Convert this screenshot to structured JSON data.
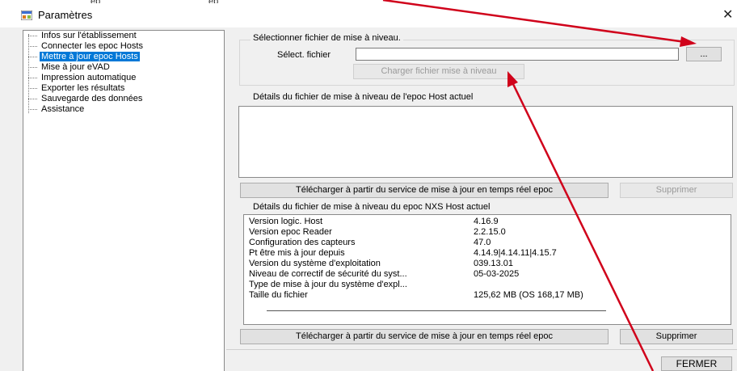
{
  "window": {
    "title": "Paramètres",
    "close_glyph": "✕"
  },
  "top_fragments": [
    "ep",
    "ep"
  ],
  "tree": {
    "items": [
      {
        "label": "Infos sur l'établissement",
        "selected": false
      },
      {
        "label": "Connecter les epoc Hosts",
        "selected": false
      },
      {
        "label": "Mettre à jour epoc Hosts",
        "selected": true
      },
      {
        "label": "Mise à jour eVAD",
        "selected": false
      },
      {
        "label": "Impression automatique",
        "selected": false
      },
      {
        "label": "Exporter les résultats",
        "selected": false
      },
      {
        "label": "Sauvegarde des données",
        "selected": false
      },
      {
        "label": "Assistance",
        "selected": false
      }
    ]
  },
  "upgrade_file": {
    "group_label": "Sélectionner fichier de mise à niveau.",
    "select_label": "Sélect. fichier",
    "file_value": "",
    "browse_label": "...",
    "load_label": "Charger fichier mise à niveau"
  },
  "current_details": {
    "label": "Détails du fichier de mise à niveau de l'epoc Host actuel",
    "download_label": "Télécharger à partir du service de mise à jour en temps réel epoc",
    "delete_label": "Supprimer"
  },
  "nxs_details": {
    "label": "Détails du fichier de mise à niveau du epoc NXS Host actuel",
    "rows": [
      {
        "key": "Version logic. Host",
        "value": "4.16.9"
      },
      {
        "key": "Version epoc Reader",
        "value": "2.2.15.0"
      },
      {
        "key": "Configuration des capteurs",
        "value": "47.0"
      },
      {
        "key": "Pt être mis à jour depuis",
        "value": "4.14.9|4.14.11|4.15.7"
      },
      {
        "key": "Version du système d'exploitation",
        "value": "039.13.01"
      },
      {
        "key": "Niveau de correctif de sécurité du syst...",
        "value": "05-03-2025"
      },
      {
        "key": "Type de mise à jour du système d'expl...",
        "value": ""
      },
      {
        "key": "Taille du fichier",
        "value": "125,62 MB (OS 168,17 MB)"
      }
    ],
    "download_label": "Télécharger à partir du service de mise à jour en temps réel epoc",
    "delete_label": "Supprimer"
  },
  "footer": {
    "close_label": "FERMER"
  },
  "colors": {
    "selection": "#0078d7",
    "arrow": "#d0021b"
  }
}
